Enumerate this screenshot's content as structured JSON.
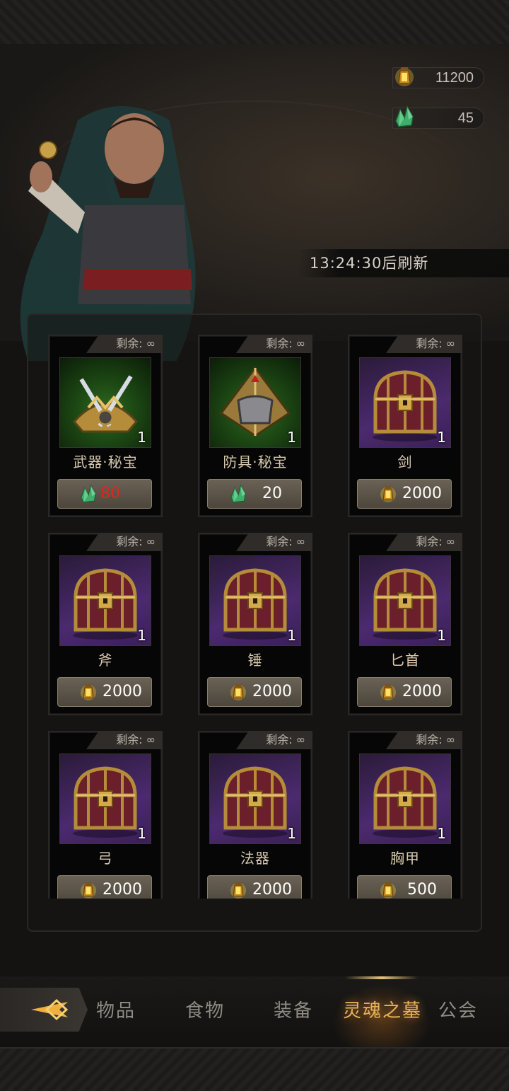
{
  "currencies": [
    {
      "name": "gold-lantern",
      "value": "11200"
    },
    {
      "name": "soul-crystal",
      "value": "45"
    }
  ],
  "refresh_timer": "13:24:30后刷新",
  "items": [
    {
      "stock": "剩余: ∞",
      "name": "武器·秘宝",
      "qty": "1",
      "price": "80",
      "currency": "soul-crystal",
      "price_color": "#e0261f",
      "thumb": "green",
      "art": "weapon"
    },
    {
      "stock": "剩余: ∞",
      "name": "防具·秘宝",
      "qty": "1",
      "price": "20",
      "currency": "soul-crystal",
      "price_color": "#ffffff",
      "thumb": "green",
      "art": "armor"
    },
    {
      "stock": "剩余: ∞",
      "name": "剑",
      "qty": "1",
      "price": "2000",
      "currency": "gold-lantern",
      "price_color": "#ffffff",
      "thumb": "purple",
      "art": "chest"
    },
    {
      "stock": "剩余: ∞",
      "name": "斧",
      "qty": "1",
      "price": "2000",
      "currency": "gold-lantern",
      "price_color": "#ffffff",
      "thumb": "purple",
      "art": "chest"
    },
    {
      "stock": "剩余: ∞",
      "name": "锤",
      "qty": "1",
      "price": "2000",
      "currency": "gold-lantern",
      "price_color": "#ffffff",
      "thumb": "purple",
      "art": "chest"
    },
    {
      "stock": "剩余: ∞",
      "name": "匕首",
      "qty": "1",
      "price": "2000",
      "currency": "gold-lantern",
      "price_color": "#ffffff",
      "thumb": "purple",
      "art": "chest"
    },
    {
      "stock": "剩余: ∞",
      "name": "弓",
      "qty": "1",
      "price": "2000",
      "currency": "gold-lantern",
      "price_color": "#ffffff",
      "thumb": "purple",
      "art": "chest"
    },
    {
      "stock": "剩余: ∞",
      "name": "法器",
      "qty": "1",
      "price": "2000",
      "currency": "gold-lantern",
      "price_color": "#ffffff",
      "thumb": "purple",
      "art": "chest"
    },
    {
      "stock": "剩余: ∞",
      "name": "胸甲",
      "qty": "1",
      "price": "500",
      "currency": "gold-lantern",
      "price_color": "#ffffff",
      "thumb": "purple",
      "art": "chest"
    }
  ],
  "tabs": [
    {
      "label": "物品",
      "active": false
    },
    {
      "label": "食物",
      "active": false
    },
    {
      "label": "装备",
      "active": false
    },
    {
      "label": "灵魂之墓",
      "active": true
    },
    {
      "label": "公会",
      "active": false
    }
  ],
  "colors": {
    "accent": "#e8b25a",
    "text_gold": "#d6c8ae",
    "price_red": "#e0261f"
  }
}
